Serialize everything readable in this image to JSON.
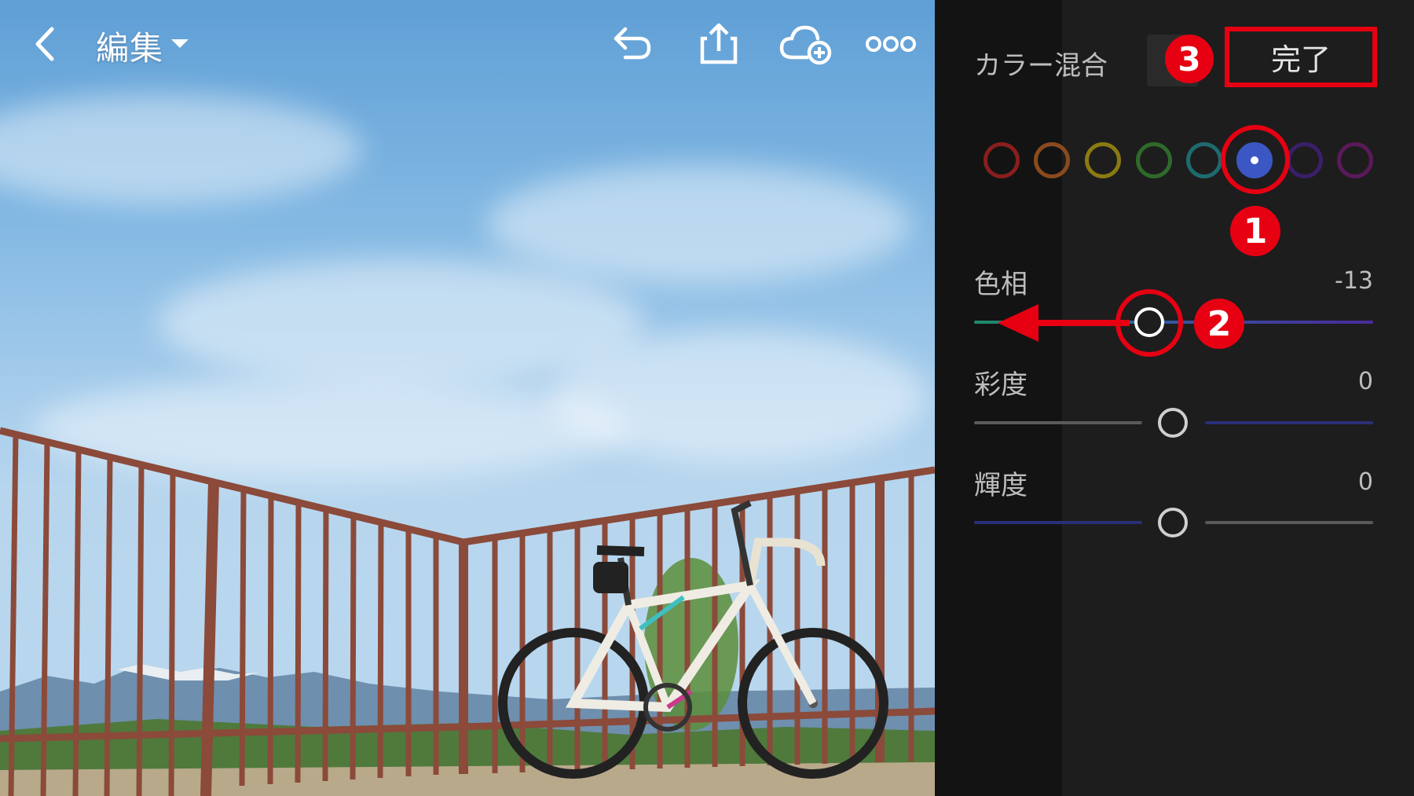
{
  "toolbar": {
    "back_icon": "chevron-left-icon",
    "edit_label": "編集",
    "undo_icon": "undo-icon",
    "share_icon": "share-icon",
    "cloud_icon": "cloud-add-icon",
    "more_icon": "more-icon"
  },
  "panel": {
    "title": "カラー混合",
    "done_label": "完了",
    "reset_icon": "reset-icon",
    "colors": {
      "swatches": [
        {
          "name": "red",
          "hex": "#8a1e1e"
        },
        {
          "name": "orange",
          "hex": "#8a4a1e"
        },
        {
          "name": "yellow",
          "hex": "#8a7a12"
        },
        {
          "name": "green",
          "hex": "#2e6a2a"
        },
        {
          "name": "aqua",
          "hex": "#1e6a70"
        },
        {
          "name": "blue",
          "hex": "#3b57c4",
          "selected": true
        },
        {
          "name": "purple",
          "hex": "#3a1f6a"
        },
        {
          "name": "magenta",
          "hex": "#5a1a5a"
        }
      ]
    },
    "sliders": [
      {
        "label": "色相",
        "value": "-13"
      },
      {
        "label": "彩度",
        "value": "0"
      },
      {
        "label": "輝度",
        "value": "0"
      }
    ]
  },
  "annotations": {
    "marker_1": "1",
    "marker_2": "2",
    "marker_3": "3",
    "accent_color": "#e60012"
  }
}
